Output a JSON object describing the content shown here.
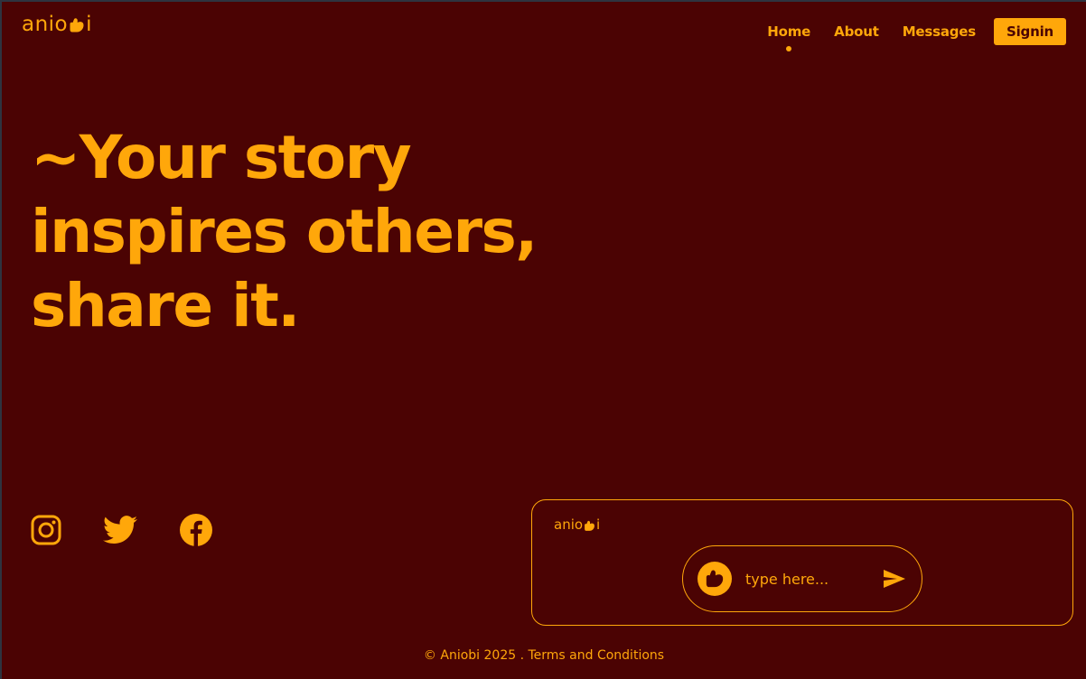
{
  "brand": {
    "logo_prefix": "anio",
    "logo_suffix": "i",
    "logo_icon": "heart-icon"
  },
  "nav": {
    "items": [
      {
        "label": "Home",
        "active": true
      },
      {
        "label": "About",
        "active": false
      },
      {
        "label": "Messages",
        "active": false
      }
    ],
    "signin_label": "Signin"
  },
  "hero": {
    "line1": "~Your story",
    "line2": "inspires others,",
    "line3": "share it."
  },
  "socials": [
    "instagram-icon",
    "twitter-icon",
    "facebook-icon"
  ],
  "composer": {
    "brand_prefix": "anio",
    "brand_suffix": "i",
    "input_placeholder": "type here...",
    "send_icon": "send-icon",
    "avatar_icon": "heart-icon"
  },
  "footer": {
    "copyright": "© Aniobi 2025",
    "terms_link": ". Terms and Conditions"
  },
  "colors": {
    "background": "#4b0303",
    "accent": "#ffa70a"
  }
}
